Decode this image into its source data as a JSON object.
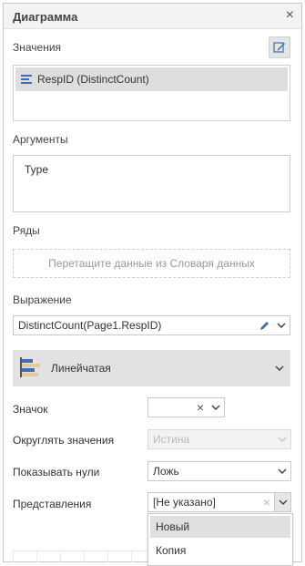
{
  "dialog": {
    "title": "Диаграмма",
    "close_icon": "×"
  },
  "values": {
    "label": "Значения",
    "items": [
      "RespID (DistinctCount)"
    ]
  },
  "arguments": {
    "label": "Аргументы",
    "items": [
      "Type"
    ]
  },
  "series": {
    "label": "Ряды",
    "placeholder": "Перетащите данные из Словаря данных"
  },
  "expression": {
    "label": "Выражение",
    "value": "DistinctCount(Page1.RespID)"
  },
  "chart_type": {
    "label": "Линейчатая"
  },
  "properties": {
    "icon": {
      "label": "Значок",
      "value": "",
      "clear": "×"
    },
    "round": {
      "label": "Округлять значения",
      "value": "Истина"
    },
    "show_zero": {
      "label": "Показывать нули",
      "value": "Ложь"
    },
    "views": {
      "label": "Представления",
      "value": "[Не указано]",
      "clear": "×"
    }
  },
  "views_dropdown": {
    "options": [
      "Новый",
      "Копия"
    ],
    "highlighted_index": 0
  },
  "colors": {
    "accent": "#3e6db5",
    "bar_tan": "#e8c79a"
  }
}
